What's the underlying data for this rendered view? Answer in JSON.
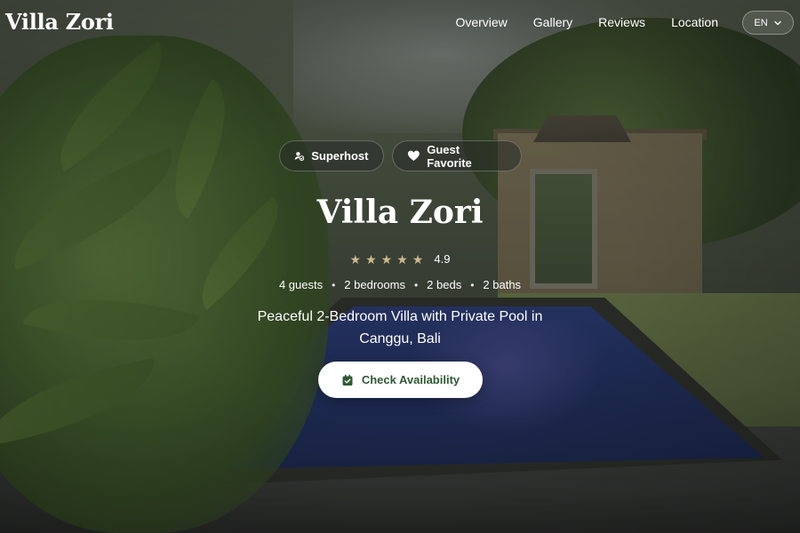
{
  "header": {
    "brand": "Villa Zori",
    "nav": [
      "Overview",
      "Gallery",
      "Reviews",
      "Location"
    ],
    "language": "EN"
  },
  "hero": {
    "badges": [
      {
        "label": "Superhost",
        "icon": "user-check-icon"
      },
      {
        "label": "Guest Favorite",
        "icon": "heart-icon"
      }
    ],
    "title": "Villa Zori",
    "rating": {
      "stars": 5,
      "value": "4.9"
    },
    "facts": [
      "4 guests",
      "2 bedrooms",
      "2 beds",
      "2 baths"
    ],
    "fact_separator": "•",
    "tagline": "Peaceful 2-Bedroom Villa with Private Pool in Canggu, Bali",
    "cta_label": "Check Availability",
    "cta_icon": "calendar-check-icon"
  },
  "colors": {
    "accent_text": "#2e5a34",
    "star": "#cdb98f",
    "cta_background": "#ffffff"
  }
}
